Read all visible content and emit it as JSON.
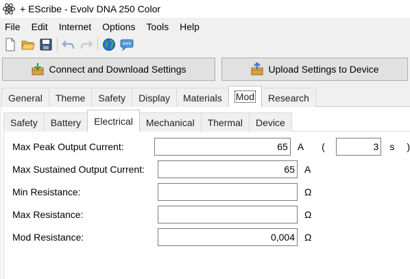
{
  "window": {
    "title": "+ EScribe - Evolv DNA 250 Color",
    "icon": "atom-icon"
  },
  "menu": [
    "File",
    "Edit",
    "Internet",
    "Options",
    "Tools",
    "Help"
  ],
  "toolbar": {
    "icons": [
      "new-file-icon",
      "open-folder-icon",
      "save-icon",
      "undo-icon",
      "redo-icon",
      "globe-icon",
      "chat-icon"
    ]
  },
  "buttons": {
    "connect_download": "Connect and Download Settings",
    "upload": "Upload Settings to Device"
  },
  "main_tabs": [
    "General",
    "Theme",
    "Safety",
    "Display",
    "Materials",
    "Mod",
    "Research"
  ],
  "main_tab_active": "Mod",
  "sub_tabs": [
    "Safety",
    "Battery",
    "Electrical",
    "Mechanical",
    "Thermal",
    "Device"
  ],
  "sub_tab_active": "Electrical",
  "fields": {
    "max_peak": {
      "label": "Max Peak Output Current:",
      "value": "65",
      "unit": "A",
      "open_paren": "(",
      "duration_value": "3",
      "duration_unit": "s",
      "close_paren": ")"
    },
    "max_sustained": {
      "label": "Max Sustained Output Current:",
      "value": "65",
      "unit": "A"
    },
    "min_resistance": {
      "label": "Min Resistance:",
      "value": "",
      "unit": "Ω"
    },
    "max_resistance": {
      "label": "Max Resistance:",
      "value": "",
      "unit": "Ω"
    },
    "mod_resistance": {
      "label": "Mod Resistance:",
      "value": "0,004",
      "unit": "Ω"
    }
  },
  "colors": {
    "accent": "#0078d7",
    "panel": "#ffffff",
    "chrome": "#f0f0f0"
  }
}
